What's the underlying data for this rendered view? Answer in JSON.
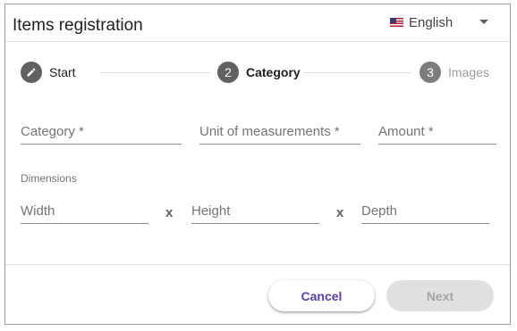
{
  "header": {
    "title": "Items registration",
    "language": {
      "flag": "us-flag-icon",
      "label": "English"
    }
  },
  "stepper": {
    "steps": [
      {
        "number": "",
        "icon": "pencil-icon",
        "label": "Start",
        "state": "completed"
      },
      {
        "number": "2",
        "label": "Category",
        "state": "active"
      },
      {
        "number": "3",
        "label": "Images",
        "state": "pending"
      }
    ]
  },
  "form": {
    "category": {
      "placeholder": "Category *",
      "value": ""
    },
    "unit": {
      "placeholder": "Unit of measurements *",
      "value": ""
    },
    "amount": {
      "placeholder": "Amount *",
      "value": ""
    },
    "dimensions": {
      "label": "Dimensions",
      "separator": "x",
      "width": {
        "placeholder": "Width",
        "value": ""
      },
      "height": {
        "placeholder": "Height",
        "value": ""
      },
      "depth": {
        "placeholder": "Depth",
        "value": ""
      }
    }
  },
  "footer": {
    "cancel_label": "Cancel",
    "next_label": "Next",
    "next_enabled": false
  },
  "colors": {
    "accent": "#5c3ea8",
    "step_active": "#616161",
    "disabled_button": "#e0e0e0"
  }
}
